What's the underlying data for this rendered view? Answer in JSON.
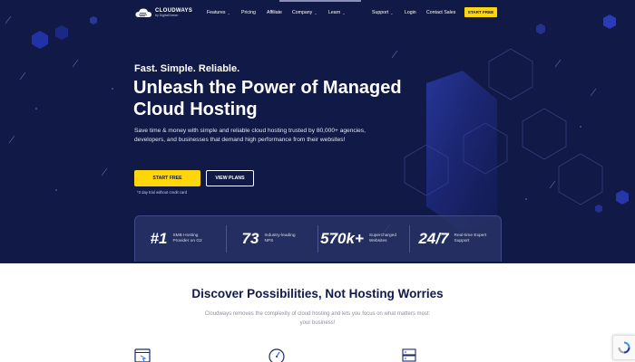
{
  "colors": {
    "hero_bg": "#111946",
    "accent_yellow": "#ffd60a",
    "heading_dark": "#111946",
    "muted_text": "#8a8fa3"
  },
  "logo": {
    "name": "CLOUDWAYS",
    "sub": "by DigitalOcean",
    "icon": "cloud-logo-icon"
  },
  "nav": {
    "features": "Features",
    "pricing": "Pricing",
    "affiliate": "Affiliate",
    "company": "Company",
    "learn": "Learn",
    "support": "Support",
    "login": "Login",
    "contact": "Contact Sales",
    "start_free": "START FREE"
  },
  "hero": {
    "tagline": "Fast. Simple. Reliable.",
    "headline": "Unleash the Power of Managed Cloud Hosting",
    "description": "Save time & money with simple and reliable cloud hosting trusted by 80,000+ agencies, developers, and businesses that demand high performance from their websites!",
    "start_button": "START FREE",
    "plans_button": "VIEW PLANS",
    "trial_note": "*3 day trial without credit card"
  },
  "stats": [
    {
      "number": "#1",
      "label": "SMB Hosting Provider on G2"
    },
    {
      "number": "73",
      "label": "Industry-leading NPS"
    },
    {
      "number": "570k+",
      "label": "Supercharged Websites"
    },
    {
      "number": "24/7",
      "label": "Real-time Expert Support"
    }
  ],
  "section": {
    "title": "Discover Possibilities, Not Hosting Worries",
    "description": "Cloudways removes the complexity of cloud hosting and lets you focus on what matters most: your business!"
  },
  "feature_icons": [
    "browser-window-icon",
    "speedometer-icon",
    "server-stack-icon"
  ],
  "recaptcha_icon": "recaptcha-icon"
}
